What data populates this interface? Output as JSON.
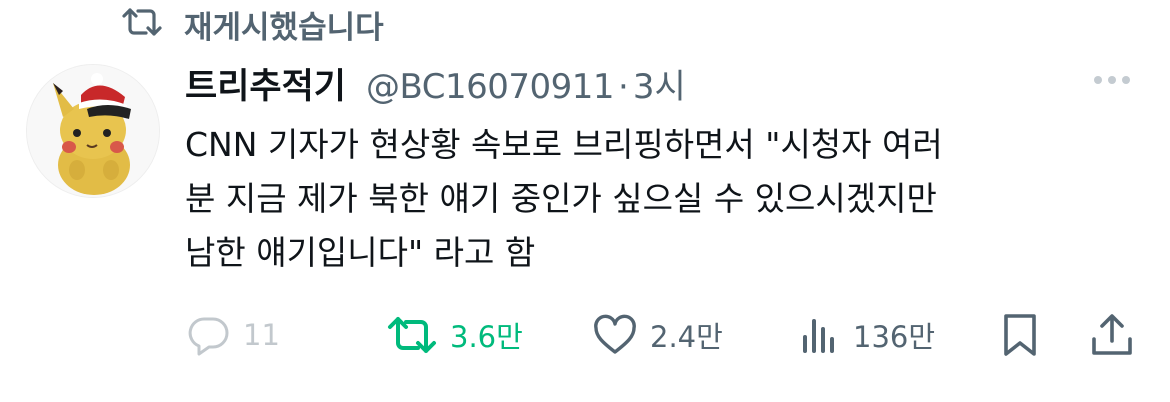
{
  "repost_banner": {
    "text": "재게시했습니다",
    "icon": "repost-icon"
  },
  "author": {
    "display_name": "트리추적기",
    "handle": "@BC16070911",
    "separator": "·",
    "time": "3시"
  },
  "tweet": {
    "text": "CNN 기자가 현상황 속보로 브리핑하면서 \"시청자 여러\n분 지금 제가 북한 얘기 중인가 싶으실 수 있으시겠지만\n남한 얘기입니다\" 라고 함"
  },
  "actions": {
    "reply": {
      "count": "11",
      "icon": "reply-icon"
    },
    "retweet": {
      "count": "3.6만",
      "icon": "retweet-icon",
      "color": "#00ba7c"
    },
    "like": {
      "count": "2.4만",
      "icon": "heart-icon"
    },
    "views": {
      "count": "136만",
      "icon": "views-icon"
    },
    "bookmark": {
      "icon": "bookmark-icon"
    },
    "share": {
      "icon": "share-icon"
    }
  },
  "colors": {
    "secondary_text": "#536471",
    "primary_text": "#0f1419",
    "accent_green": "#00ba7c"
  }
}
